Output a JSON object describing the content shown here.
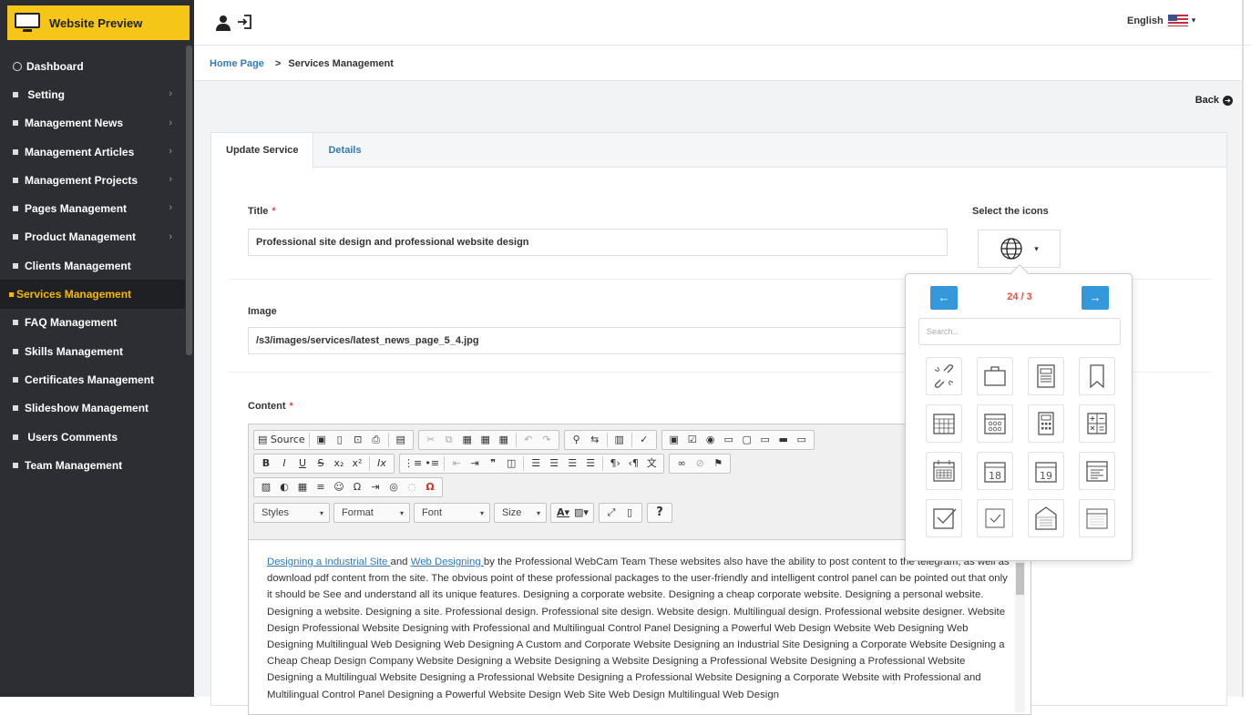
{
  "brand": {
    "title": "Website Preview"
  },
  "sidebar": {
    "items": [
      {
        "label": "Dashboard"
      },
      {
        "label": "Setting",
        "chevron": "›"
      },
      {
        "label": "Management News",
        "chevron": "›"
      },
      {
        "label": "Management Articles",
        "chevron": "›"
      },
      {
        "label": "Management Projects",
        "chevron": "›"
      },
      {
        "label": "Pages Management",
        "chevron": "›"
      },
      {
        "label": "Product Management",
        "chevron": "›"
      },
      {
        "label": "Clients Management"
      },
      {
        "label": "Services Management"
      },
      {
        "label": "FAQ Management"
      },
      {
        "label": "Skills Management"
      },
      {
        "label": "Certificates Management"
      },
      {
        "label": "Slideshow Management"
      },
      {
        "label": "Users Comments"
      },
      {
        "label": "Team Management"
      }
    ]
  },
  "header": {
    "language": "English",
    "caret": "▾"
  },
  "breadcrumb": {
    "home": "Home Page",
    "separator": ">",
    "current": "Services Management"
  },
  "actions": {
    "back": "Back",
    "back_arrow": "➜"
  },
  "tabs": [
    {
      "label": "Update Service"
    },
    {
      "label": "Details"
    }
  ],
  "form": {
    "title_label": "Title",
    "required_mark": "*",
    "title_value": "Professional site design and professional website design",
    "image_label": "Image",
    "image_value": "/s3/images/services/latest_news_page_5_4.jpg",
    "content_label": "Content",
    "icons_label": "Select the icons",
    "selected_icon": "globe-icon"
  },
  "editor": {
    "source_label": "Source",
    "styles_label": "Styles",
    "format_label": "Format",
    "font_label": "Font",
    "size_label": "Size",
    "help_label": "?",
    "link1": "Designing a Industrial Site ",
    "and_text": "and ",
    "link2": "Web Designing ",
    "body_text": "by the Professional WebCam Team These websites also have the ability to post content to the telegram, as well as download pdf content from the site. The obvious point of these professional packages to the user-friendly and intelligent control panel can be pointed out that only it should be See and understand all its unique features. Designing a corporate website. Designing a cheap corporate website. Designing a personal website. Designing a website. Designing a site. Professional design. Professional site design. Website design. Multilingual design. Professional website designer. Website Design Professional Website Designing with Professional and Multilingual Control Panel Designing a Powerful Web Design Website Web Designing Web Designing Multilingual Web Designing Web Designing A Custom and Corporate Website Designing an Industrial Site Designing a Corporate Website Designing a Cheap Cheap Design Company Website Designing a Website Designing a Website Designing a Professional Website Designing a Professional Website Designing a Multilingual Website Designing a Professional Website Designing a Professional Website Designing a Corporate Website with Professional and Multilingual Control Panel Designing a Powerful Website Design Web Site Web Design Multilingual Web Design"
  },
  "icon_picker": {
    "page_label": "24 / 3",
    "prev": "←",
    "next": "→",
    "search_placeholder": "Search...",
    "icons": [
      "unlink-icon",
      "briefcase-icon",
      "newspaper-icon",
      "bookmark-icon",
      "calendar-grid-icon",
      "calendar-dots-icon",
      "calculator-icon",
      "calculator-math-icon",
      "calendar-month-icon",
      "calendar-18-icon",
      "calendar-19-icon",
      "calendar-list-icon",
      "checkbox-checked-icon",
      "checkbox-small-icon",
      "calendar-blank-icon",
      "calendar-outline-icon"
    ],
    "cal_18": "18",
    "cal_19": "19"
  }
}
